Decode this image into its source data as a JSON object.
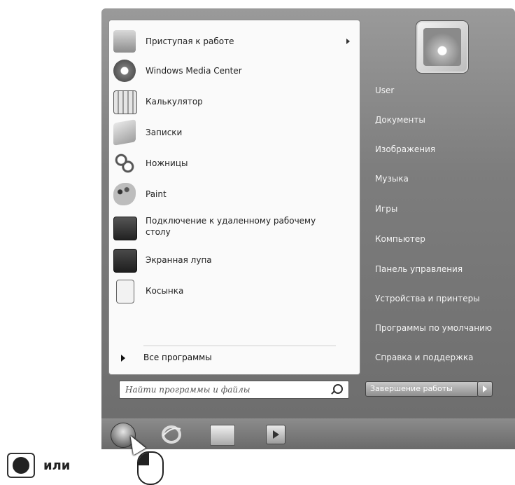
{
  "start_menu": {
    "programs": [
      {
        "label": "Приступая к работе",
        "icon": "getting-started-icon",
        "has_submenu": true
      },
      {
        "label": "Windows Media Center",
        "icon": "media-center-icon",
        "has_submenu": false
      },
      {
        "label": "Калькулятор",
        "icon": "calculator-icon",
        "has_submenu": false
      },
      {
        "label": "Записки",
        "icon": "sticky-notes-icon",
        "has_submenu": false
      },
      {
        "label": "Ножницы",
        "icon": "scissors-icon",
        "has_submenu": false
      },
      {
        "label": "Paint",
        "icon": "paint-palette-icon",
        "has_submenu": false
      },
      {
        "label": "Подключение к удаленному рабочему\nстолу",
        "icon": "remote-desktop-icon",
        "has_submenu": false
      },
      {
        "label": "Экранная лупа",
        "icon": "magnifier-icon",
        "has_submenu": false
      },
      {
        "label": "Косынка",
        "icon": "solitaire-icon",
        "has_submenu": false
      }
    ],
    "all_programs_label": "Все программы",
    "search_placeholder": "Найти программы и файлы",
    "right_links": [
      "User",
      "Документы",
      "Изображения",
      "Музыка",
      "Игры",
      "Компьютер",
      "Панель управления",
      "Устройства и принтеры",
      "Программы по умолчанию",
      "Справка и поддержка"
    ],
    "shutdown_label": "Завершение работы"
  },
  "legend": {
    "or_text": "или"
  }
}
